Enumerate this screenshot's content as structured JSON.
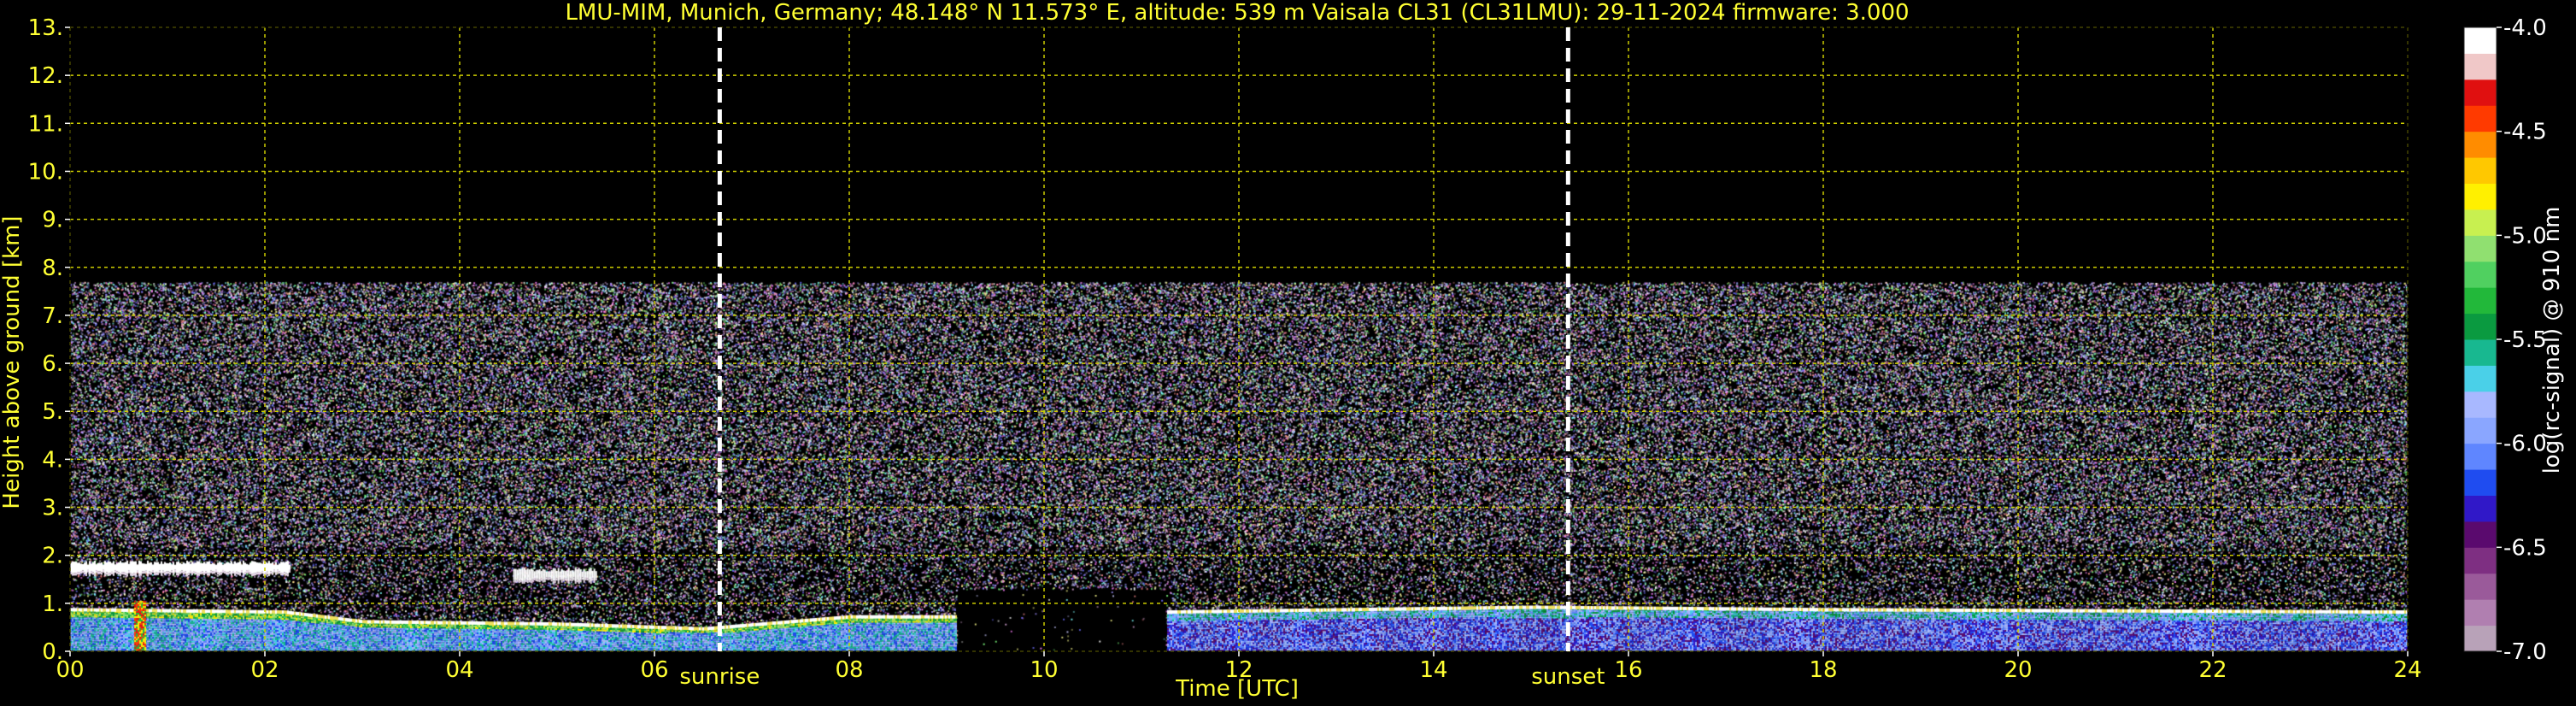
{
  "chart_data": {
    "type": "heatmap",
    "title": "LMU-MIM, Munich, Germany; 48.148° N 11.573° E, altitude: 539 m    Vaisala CL31 (CL31LMU): 29-11-2024    firmware: 3.000",
    "xlabel": "Time [UTC]",
    "ylabel": "Height above ground [km]",
    "xlim": [
      0,
      24
    ],
    "ylim": [
      0,
      13
    ],
    "x_ticks": [
      "00",
      "02",
      "04",
      "06",
      "08",
      "10",
      "12",
      "14",
      "16",
      "18",
      "20",
      "22",
      "24"
    ],
    "x_tick_values": [
      0,
      2,
      4,
      6,
      8,
      10,
      12,
      14,
      16,
      18,
      20,
      22,
      24
    ],
    "y_ticks": [
      "0.",
      "1.",
      "2.",
      "3.",
      "4.",
      "5.",
      "6.",
      "7.",
      "8.",
      "9.",
      "10.",
      "11.",
      "12.",
      "13."
    ],
    "y_tick_values": [
      0,
      1,
      2,
      3,
      4,
      5,
      6,
      7,
      8,
      9,
      10,
      11,
      12,
      13
    ],
    "grid": true,
    "events": [
      {
        "label": "sunrise",
        "time": 6.67
      },
      {
        "label": "sunset",
        "time": 15.38
      }
    ],
    "colorbar": {
      "label": "log(rc-signal) @ 910 nm",
      "range": [
        -7.0,
        -4.0
      ],
      "ticks": [
        "-4.0",
        "-4.5",
        "-5.0",
        "-5.5",
        "-6.0",
        "-6.5",
        "-7.0"
      ],
      "tick_values": [
        -4.0,
        -4.5,
        -5.0,
        -5.5,
        -6.0,
        -6.5,
        -7.0
      ],
      "colors": [
        "#b8a2b8",
        "#b07fb0",
        "#9a5a9a",
        "#7e2f82",
        "#5a0a6e",
        "#3018c8",
        "#1f4cf0",
        "#5f86ff",
        "#8aa6ff",
        "#a8b8ff",
        "#4ad0e8",
        "#18b890",
        "#0a9a40",
        "#22b83a",
        "#50d060",
        "#90e070",
        "#c8f050",
        "#fff000",
        "#ffc800",
        "#ff8c00",
        "#ff3a00",
        "#e01010",
        "#f0c8c8",
        "#ffffff"
      ]
    },
    "signal_top_km": 7.7,
    "cloud_layers": [
      {
        "start": 0.0,
        "end": 2.25,
        "height_km": 1.75
      },
      {
        "start": 4.55,
        "end": 5.4,
        "height_km": 1.6
      }
    ],
    "boundary_layer": [
      {
        "time": 0.0,
        "height_km": 0.85
      },
      {
        "time": 2.2,
        "height_km": 0.8
      },
      {
        "time": 3.0,
        "height_km": 0.6
      },
      {
        "time": 5.0,
        "height_km": 0.55
      },
      {
        "time": 6.5,
        "height_km": 0.45
      },
      {
        "time": 8.0,
        "height_km": 0.7
      },
      {
        "time": 9.1,
        "height_km": 0.7
      },
      {
        "time": 11.25,
        "height_km": 0.8
      },
      {
        "time": 15.0,
        "height_km": 0.9
      },
      {
        "time": 18.0,
        "height_km": 0.85
      },
      {
        "time": 24.0,
        "height_km": 0.8
      }
    ],
    "no_data": [
      {
        "start": 9.1,
        "end": 11.25
      }
    ]
  }
}
